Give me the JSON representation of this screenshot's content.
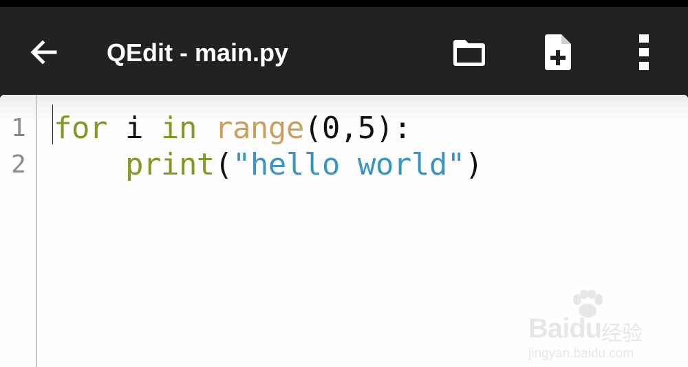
{
  "app": {
    "title": "QEdit - main.py"
  },
  "toolbar": {
    "back_icon": "arrow-left-icon",
    "open_icon": "folder-icon",
    "new_icon": "new-file-icon",
    "menu_icon": "more-vert-icon"
  },
  "editor": {
    "line_numbers": [
      "1",
      "2"
    ],
    "lines": [
      {
        "tokens": [
          {
            "text": "for",
            "type": "keyword"
          },
          {
            "text": " i ",
            "type": "plain"
          },
          {
            "text": "in",
            "type": "keyword"
          },
          {
            "text": " ",
            "type": "plain"
          },
          {
            "text": "range",
            "type": "builtin"
          },
          {
            "text": "(0,5):",
            "type": "plain"
          }
        ]
      },
      {
        "tokens": [
          {
            "text": "    ",
            "type": "plain"
          },
          {
            "text": "print",
            "type": "function"
          },
          {
            "text": "(",
            "type": "plain"
          },
          {
            "text": "\"hello world\"",
            "type": "string"
          },
          {
            "text": ")",
            "type": "plain"
          }
        ]
      }
    ]
  },
  "watermark": {
    "brand": "Baidu",
    "cn": "经验",
    "url": "jingyan.baidu.com"
  },
  "colors": {
    "toolbar_bg": "#222222",
    "keyword": "#7f9b23",
    "builtin": "#c9a05c",
    "string": "#3a94c4",
    "editor_bg": "#fefefe"
  }
}
